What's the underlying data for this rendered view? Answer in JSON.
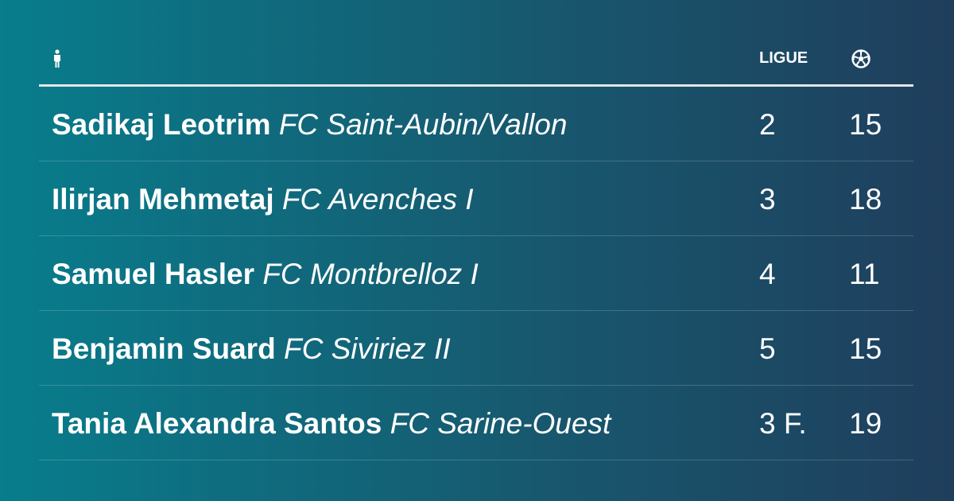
{
  "table": {
    "header": {
      "player_icon": "person-icon",
      "league_label": "LIGUE",
      "goals_icon": "soccer-ball-icon"
    },
    "rows": [
      {
        "name": "Sadikaj Leotrim",
        "club": "FC Saint-Aubin/Vallon",
        "league": "2",
        "goals": "15"
      },
      {
        "name": "Ilirjan Mehmetaj",
        "club": "FC Avenches I",
        "league": "3",
        "goals": "18"
      },
      {
        "name": "Samuel Hasler",
        "club": "FC Montbrelloz I",
        "league": "4",
        "goals": "11"
      },
      {
        "name": "Benjamin Suard",
        "club": "FC Siviriez II",
        "league": "5",
        "goals": "15"
      },
      {
        "name": "Tania Alexandra Santos",
        "club": "FC Sarine-Ouest",
        "league": "3 F.",
        "goals": "19"
      }
    ]
  },
  "colors": {
    "background_start": "#087d8c",
    "background_end": "#1f3e5c",
    "text": "#ffffff",
    "header_rule": "#e2e6ea"
  }
}
